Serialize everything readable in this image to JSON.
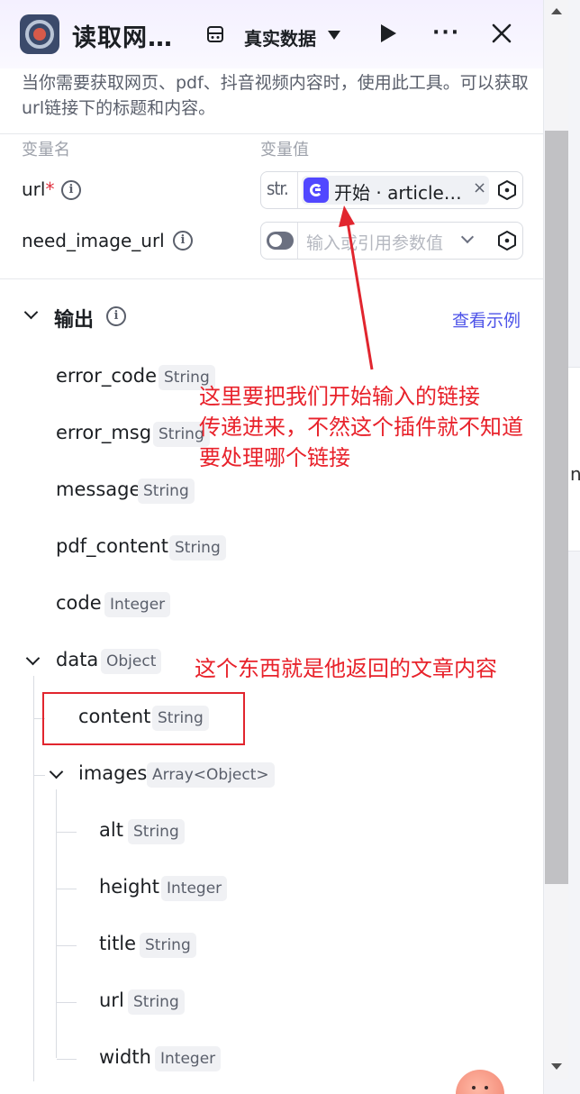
{
  "header": {
    "title": "读取网…",
    "data_select_label": "真实数据",
    "more_label": "···",
    "close_label": "✕"
  },
  "description": "当你需要获取网页、pdf、抖音视频内容时，使用此工具。可以获取url链接下的标题和内容。",
  "inputs": {
    "col_name_label": "变量名",
    "col_value_label": "变量值",
    "rows": [
      {
        "name": "url",
        "required_mark": "*",
        "type_label": "str.",
        "ref_text": "开始 · article…",
        "ref_clear": "×"
      },
      {
        "name": "need_image_url",
        "placeholder": "输入或引用参数值"
      }
    ]
  },
  "output": {
    "title": "输出",
    "example_link": "查看示例",
    "fields": [
      {
        "name": "error_code",
        "type": "String"
      },
      {
        "name": "error_msg",
        "type": "String"
      },
      {
        "name": "message",
        "type": "String"
      },
      {
        "name": "pdf_content",
        "type": "String"
      },
      {
        "name": "code",
        "type": "Integer"
      },
      {
        "name": "data",
        "type": "Object"
      },
      {
        "name": "content",
        "type": "String"
      },
      {
        "name": "images",
        "type": "Array<Object>"
      },
      {
        "name": "alt",
        "type": "String"
      },
      {
        "name": "height",
        "type": "Integer"
      },
      {
        "name": "title",
        "type": "String"
      },
      {
        "name": "url",
        "type": "String"
      },
      {
        "name": "width",
        "type": "Integer"
      }
    ]
  },
  "annotations": {
    "arrow_note": [
      "这里要把我们开始输入的链接",
      "传递进来，不然这个插件就不知道",
      "要处理哪个链接"
    ],
    "content_note": "这个东西就是他返回的文章内容",
    "color": "#e8222b"
  },
  "background": {
    "card_glyph": "ni"
  }
}
